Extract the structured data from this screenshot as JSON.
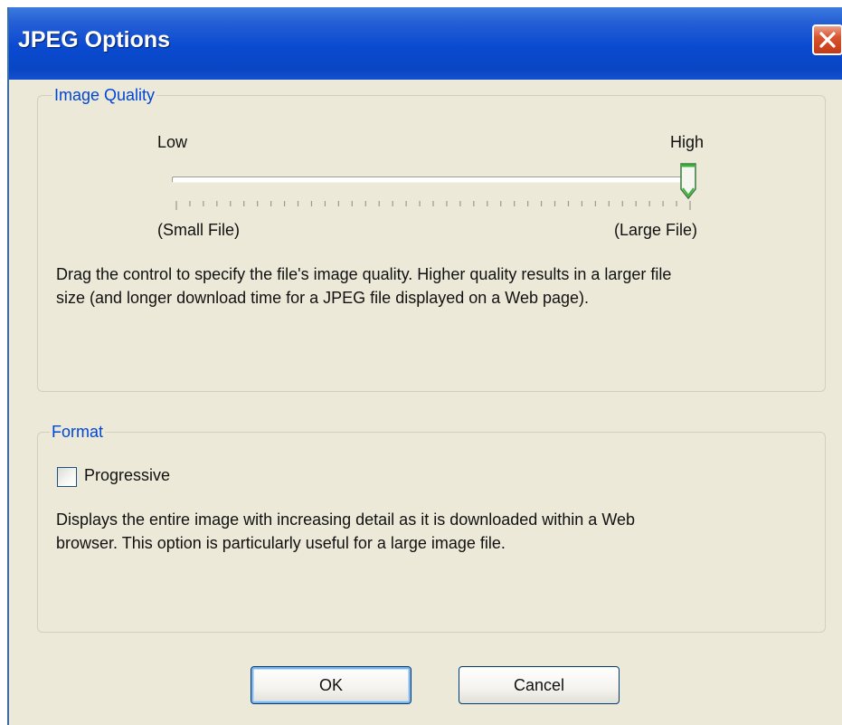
{
  "window": {
    "title": "JPEG Options"
  },
  "image_quality": {
    "group_label": "Image Quality",
    "low_label": "Low",
    "high_label": "High",
    "small_label": "(Small File)",
    "large_label": "(Large File)",
    "slider_value_fraction": 1.0,
    "description_line1": "Drag the control to specify the file's image quality.  Higher quality results in a larger file",
    "description_line2": "size (and longer download time for a JPEG file displayed on a Web page)."
  },
  "format": {
    "group_label": "Format",
    "progressive_label": "Progressive",
    "progressive_checked": false,
    "description_line1": "Displays the entire image with increasing detail as it is downloaded within a Web",
    "description_line2": "browser.  This option is particularly useful for a large image file."
  },
  "buttons": {
    "ok_label": "OK",
    "cancel_label": "Cancel"
  },
  "icons": {
    "close": "close-icon",
    "slider_thumb": "slider-thumb-icon"
  },
  "colors": {
    "titlebar": "#0a4ad0",
    "dialog_bg": "#ece9d8",
    "group_label": "#0046d5",
    "close_button": "#d8542f",
    "thumb_accent": "#3cb43c"
  }
}
